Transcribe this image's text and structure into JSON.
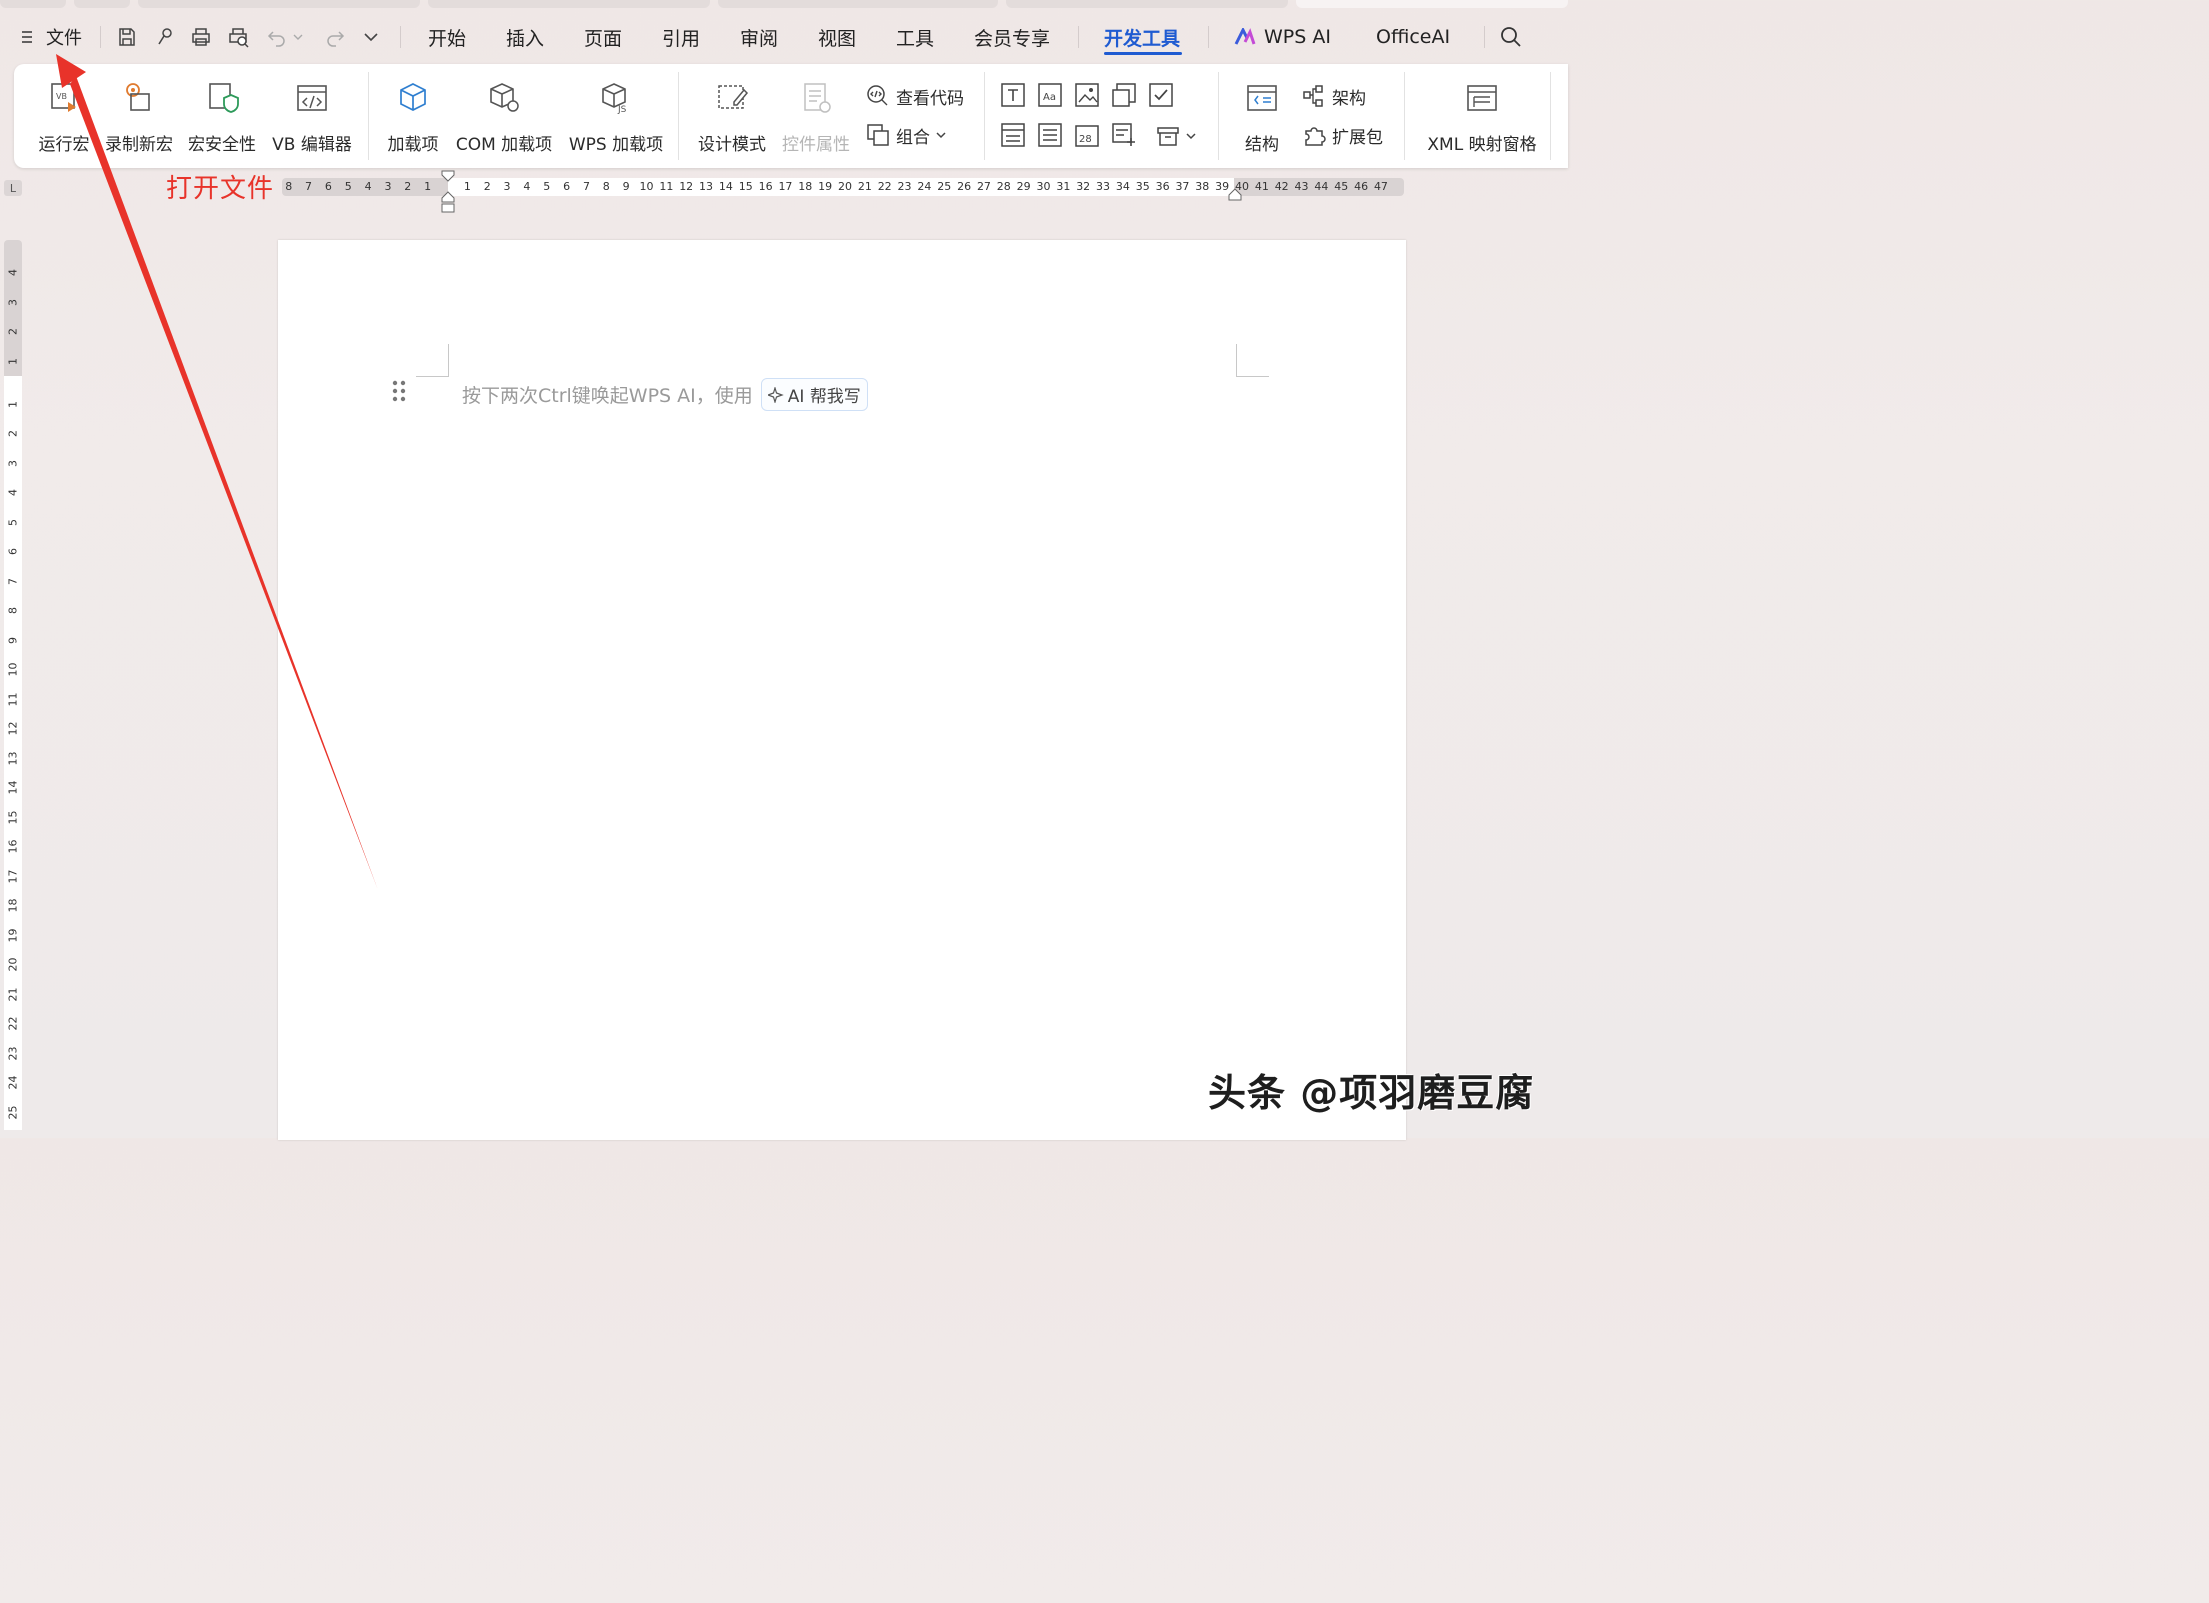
{
  "menubar": {
    "file_label": "文件",
    "tabs": [
      "开始",
      "插入",
      "页面",
      "引用",
      "审阅",
      "视图",
      "工具",
      "会员专享",
      "开发工具",
      "WPS AI",
      "OfficeAI"
    ],
    "active_tab": "开发工具"
  },
  "ribbon": {
    "run_macro": "运行宏",
    "record_macro": "录制新宏",
    "macro_security": "宏安全性",
    "vb_editor": "VB 编辑器",
    "addins": "加载项",
    "com_addins": "COM 加载项",
    "wps_addins": "WPS 加载项",
    "design_mode": "设计模式",
    "control_props": "控件属性",
    "view_code": "查看代码",
    "group": "组合",
    "structure": "结构",
    "schema": "架构",
    "expansion_pack": "扩展包",
    "xml_pane": "XML 映射窗格"
  },
  "annotation": {
    "text": "打开文件",
    "color": "#e8332a"
  },
  "ruler": {
    "corner": "L",
    "h_left": [
      "8",
      "7",
      "6",
      "5",
      "4",
      "3",
      "2",
      "1"
    ],
    "h_right": [
      "1",
      "2",
      "3",
      "4",
      "5",
      "6",
      "7",
      "8",
      "9",
      "10",
      "11",
      "12",
      "13",
      "14",
      "15",
      "16",
      "17",
      "18",
      "19",
      "20",
      "21",
      "22",
      "23",
      "24",
      "25",
      "26",
      "27",
      "28",
      "29",
      "30",
      "31",
      "32",
      "33",
      "34",
      "35",
      "36",
      "37",
      "38",
      "39",
      "40",
      "41",
      "42",
      "43",
      "44",
      "45",
      "46",
      "47"
    ],
    "v_top": [
      "4",
      "3",
      "2",
      "1"
    ],
    "v_bottom": [
      "1",
      "2",
      "3",
      "4",
      "5",
      "6",
      "7",
      "8",
      "9",
      "10",
      "11",
      "12",
      "13",
      "14",
      "15",
      "16",
      "17",
      "18",
      "19",
      "20",
      "21",
      "22",
      "23",
      "24",
      "25"
    ]
  },
  "document": {
    "hint": "按下两次Ctrl键唤起WPS AI，使用",
    "ai_chip": "AI 帮我写"
  },
  "watermark": "头条 @项羽磨豆腐",
  "colors": {
    "accent": "#1f5bd1",
    "annotation": "#e8332a"
  }
}
